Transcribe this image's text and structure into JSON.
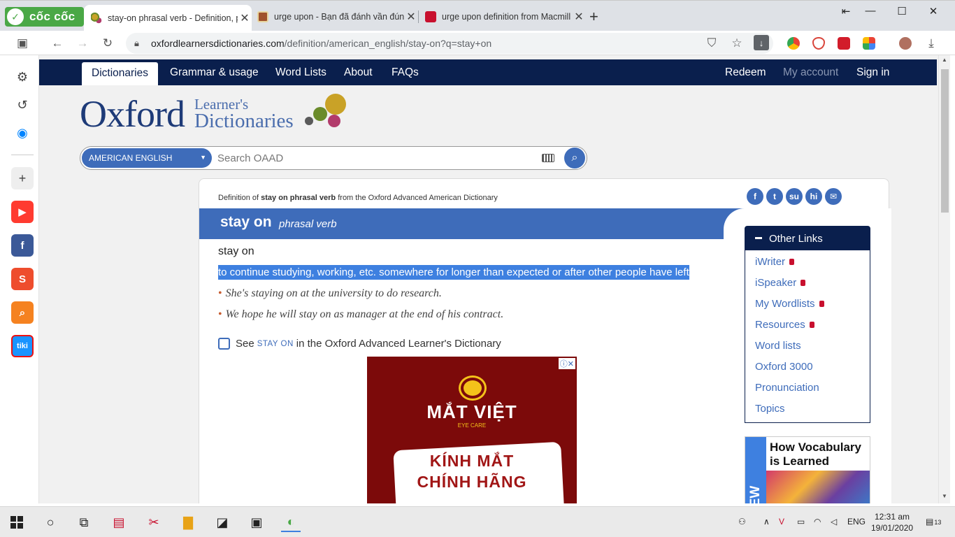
{
  "browser": {
    "brand": "cốc cốc",
    "tabs": [
      {
        "title": "stay-on phrasal verb - Definition, p",
        "active": true
      },
      {
        "title": "urge upon - Bạn đã đánh vần đúng",
        "active": false
      },
      {
        "title": "urge upon definition from Macmill",
        "active": false
      }
    ],
    "url_domain": "oxfordlearnersdictionaries.com",
    "url_path": "/definition/american_english/stay-on?q=stay+on",
    "win_controls": {
      "restore": "⇤",
      "minimize": "—",
      "maximize": "☐",
      "close": "✕"
    }
  },
  "site_nav": {
    "left": [
      "Dictionaries",
      "Grammar & usage",
      "Word Lists",
      "About",
      "FAQs"
    ],
    "right": [
      "Redeem",
      "My account",
      "Sign in"
    ]
  },
  "logo": {
    "main": "Oxford",
    "line1": "Learner's",
    "line2": "Dictionaries"
  },
  "search": {
    "dictionary": "AMERICAN ENGLISH",
    "placeholder": "Search OAAD"
  },
  "entry": {
    "definition_of_prefix": "Definition of",
    "definition_of_word": "stay on phrasal verb",
    "definition_of_suffix": "from the Oxford Advanced American Dictionary",
    "headword": "stay on",
    "pos": "phrasal verb",
    "phrase": "stay on",
    "definition": "to continue studying, working, etc. somewhere for longer than expected or after other people have left",
    "examples": [
      "She's staying on at the university to do research.",
      "We hope he will stay on as manager at the end of his contract."
    ],
    "see_prefix": "See",
    "see_word": "STAY ON",
    "see_suffix": "in the Oxford Advanced Learner's Dictionary"
  },
  "share_icons": [
    "f",
    "t",
    "su",
    "hi",
    "✉"
  ],
  "ad": {
    "brand": "MẮT VIỆT",
    "tagline": "EYE CARE",
    "line1": "KÍNH MẮT",
    "line2": "CHÍNH HÃNG",
    "badge": "ⓘ✕"
  },
  "other_links": {
    "title": "Other Links",
    "items": [
      {
        "label": "iWriter",
        "locked": true
      },
      {
        "label": "iSpeaker",
        "locked": true
      },
      {
        "label": "My Wordlists",
        "locked": true
      },
      {
        "label": "Resources",
        "locked": true
      },
      {
        "label": "Word lists",
        "locked": false
      },
      {
        "label": "Oxford 3000",
        "locked": false
      },
      {
        "label": "Pronunciation",
        "locked": false
      },
      {
        "label": "Topics",
        "locked": false
      }
    ]
  },
  "promo": {
    "badge": "NEW",
    "title": "How Vocabulary is Learned"
  },
  "taskbar": {
    "lang": "ENG",
    "time": "12:31 am",
    "date": "19/01/2020",
    "notif_count": "13"
  }
}
